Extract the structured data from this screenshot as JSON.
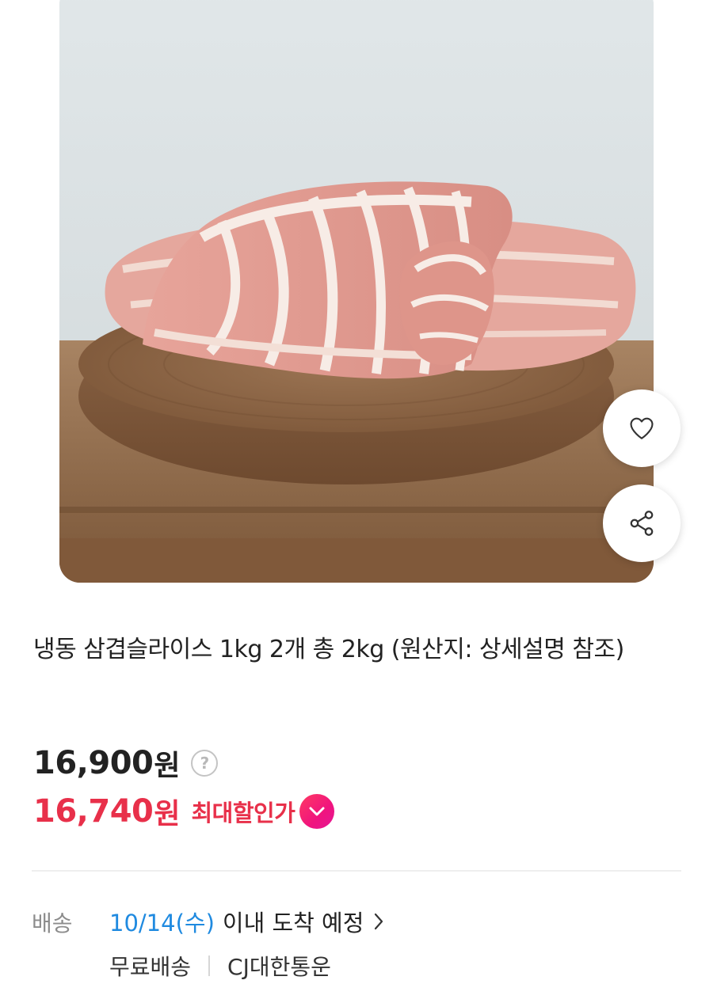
{
  "product": {
    "image_icon": "pork-belly-photo",
    "title": "냉동 삼겹슬라이스 1kg 2개 총 2kg (원산지: 상세설명 참조)"
  },
  "actions": {
    "like_icon": "heart-icon",
    "share_icon": "share-icon"
  },
  "price": {
    "regular_amount": "16,900",
    "regular_unit": "원",
    "help_symbol": "?",
    "sale_amount": "16,740",
    "sale_unit": "원",
    "discount_label": "최대할인가",
    "sale_color": "#e8304a"
  },
  "shipping": {
    "label": "배송",
    "date": "10/14(수)",
    "arrival_text": "이내 도착 예정",
    "fee": "무료배송",
    "carrier": "CJ대한통운",
    "date_color": "#1f8ae0"
  }
}
